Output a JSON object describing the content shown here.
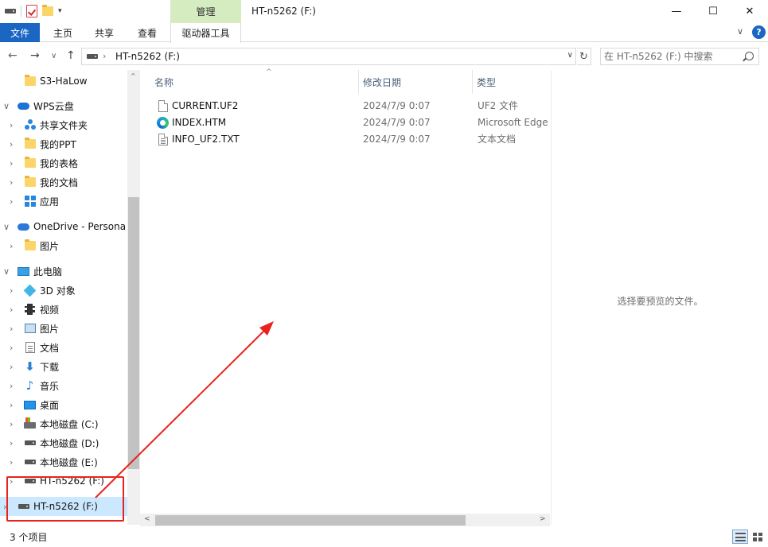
{
  "window": {
    "title": "HT-n5262 (F:)",
    "context_tab_group": "管理",
    "minimize_glyph": "—",
    "maximize_glyph": "☐",
    "close_glyph": "✕"
  },
  "ribbon": {
    "tabs": [
      "文件",
      "主页",
      "共享",
      "查看",
      "驱动器工具"
    ],
    "expand_glyph": "∨",
    "help_glyph": "?"
  },
  "address": {
    "back_glyph": "←",
    "forward_glyph": "→",
    "recent_glyph": "∨",
    "up_glyph": "↑",
    "chevron": "›",
    "path": "HT-n5262 (F:)",
    "dropdown_glyph": "∨",
    "refresh_glyph": "↻"
  },
  "search": {
    "placeholder": "在 HT-n5262 (F:) 中搜索"
  },
  "nav": {
    "items": [
      {
        "label": "S3-HaLow",
        "icon": "folder-icon"
      },
      {
        "label": "WPS云盘",
        "icon": "cloud-icon"
      },
      {
        "label": "共享文件夹",
        "icon": "share-icon"
      },
      {
        "label": "我的PPT",
        "icon": "folder-icon"
      },
      {
        "label": "我的表格",
        "icon": "folder-icon"
      },
      {
        "label": "我的文档",
        "icon": "folder-icon"
      },
      {
        "label": "应用",
        "icon": "apps-icon"
      },
      {
        "label": "OneDrive - Persona",
        "icon": "cloud-icon"
      },
      {
        "label": "图片",
        "icon": "folder-icon"
      },
      {
        "label": "此电脑",
        "icon": "computer-icon"
      },
      {
        "label": "3D 对象",
        "icon": "cube-icon"
      },
      {
        "label": "视频",
        "icon": "film-icon"
      },
      {
        "label": "图片",
        "icon": "picture-icon"
      },
      {
        "label": "文档",
        "icon": "document-icon"
      },
      {
        "label": "下载",
        "icon": "download-icon"
      },
      {
        "label": "音乐",
        "icon": "music-icon"
      },
      {
        "label": "桌面",
        "icon": "desktop-icon"
      },
      {
        "label": "本地磁盘 (C:)",
        "icon": "system-drive-icon"
      },
      {
        "label": "本地磁盘 (D:)",
        "icon": "drive-icon"
      },
      {
        "label": "本地磁盘 (E:)",
        "icon": "drive-icon"
      },
      {
        "label": "HT-n5262 (F:)",
        "icon": "drive-icon"
      },
      {
        "label": "HT-n5262 (F:)",
        "icon": "drive-icon"
      }
    ],
    "expander_collapsed": "›",
    "expander_expanded": "∨"
  },
  "columns": {
    "name": "名称",
    "date": "修改日期",
    "type": "类型",
    "sort_glyph": "^"
  },
  "files": [
    {
      "name": "CURRENT.UF2",
      "date": "2024/7/9 0:07",
      "type": "UF2 文件",
      "icon": "file-icon"
    },
    {
      "name": "INDEX.HTM",
      "date": "2024/7/9 0:07",
      "type": "Microsoft Edge",
      "icon": "edge-icon"
    },
    {
      "name": "INFO_UF2.TXT",
      "date": "2024/7/9 0:07",
      "type": "文本文档",
      "icon": "text-file-icon"
    }
  ],
  "preview": {
    "message": "选择要预览的文件。"
  },
  "status": {
    "item_count": "3 个项目"
  },
  "scroll": {
    "left_glyph": "<",
    "right_glyph": ">",
    "up_glyph": "^"
  },
  "colors": {
    "accent": "#1a66c2",
    "context_tab": "#d5ecc0",
    "selection": "#cce8ff",
    "annotation": "#e8231d"
  }
}
